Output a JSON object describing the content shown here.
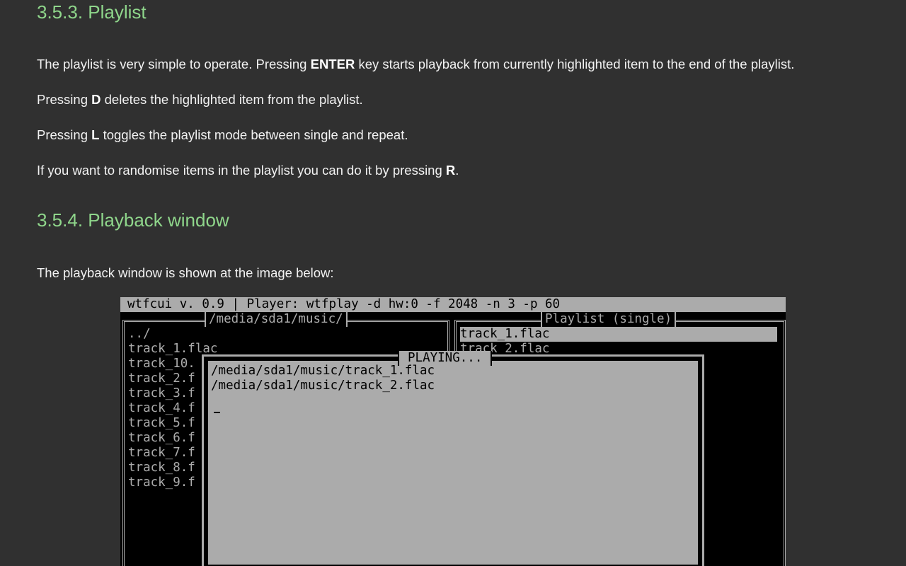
{
  "sections": {
    "playlist": {
      "heading": "3.5.3. Playlist",
      "paragraphs": {
        "p1": {
          "before": "The playlist is very simple to operate. Pressing ",
          "key": "ENTER",
          "after": " key starts playback from currently highlighted item to the end of the playlist."
        },
        "p2": {
          "before": "Pressing ",
          "key": "D",
          "after": " deletes the highlighted item from the playlist."
        },
        "p3": {
          "before": "Pressing ",
          "key": "L",
          "after": " toggles the playlist mode between single and repeat."
        },
        "p4": {
          "before": "If you want to randomise items in the playlist you can do it by pressing ",
          "key": "R",
          "after": "."
        }
      }
    },
    "playback": {
      "heading": "3.5.4. Playback window",
      "intro": "The playback window is shown at the image below:"
    }
  },
  "terminal": {
    "titlebar": "wtfcui v. 0.9 | Player: wtfplay -d hw:0 -f 2048 -n 3 -p 60",
    "browser": {
      "title": "/media/sda1/music/",
      "items": [
        "../",
        "track_1.flac",
        "track_10.",
        "track_2.f",
        "track_3.f",
        "track_4.f",
        "track_5.f",
        "track_6.f",
        "track_7.f",
        "track_8.f",
        "track_9.f"
      ]
    },
    "playlist": {
      "title": "Playlist (single)",
      "items": [
        "track_1.flac",
        "track_2.flac"
      ]
    },
    "playing": {
      "title": "PLAYING...",
      "lines": [
        "/media/sda1/music/track_1.flac",
        "/media/sda1/music/track_2.flac"
      ]
    }
  }
}
